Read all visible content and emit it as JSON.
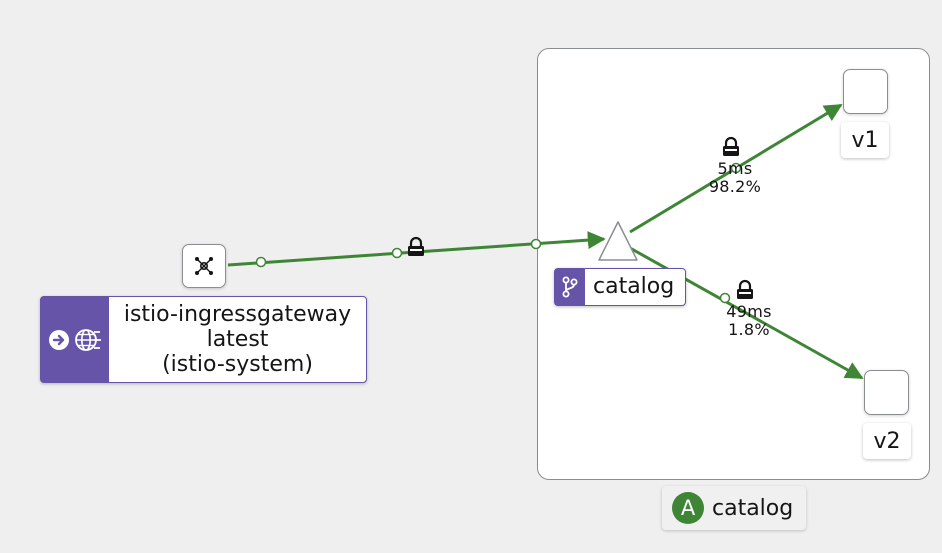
{
  "ingress": {
    "name": "istio-ingressgateway",
    "version": "latest",
    "namespace": "(istio-system)"
  },
  "service": {
    "name": "catalog"
  },
  "app": {
    "badge": "A",
    "name": "catalog"
  },
  "versions": [
    {
      "label": "v1"
    },
    {
      "label": "v2"
    }
  ],
  "edges": [
    {
      "from": "istio-ingressgateway",
      "to": "catalog",
      "mtls": true
    },
    {
      "from": "catalog",
      "to": "v1",
      "mtls": true,
      "response_time": "5ms",
      "percent": "98.2%"
    },
    {
      "from": "catalog",
      "to": "v2",
      "mtls": true,
      "response_time": "49ms",
      "percent": "1.8%"
    }
  ],
  "colors": {
    "edge": "#3e8635",
    "badge": "#6554a8",
    "app_badge": "#3e8635",
    "node_border": "#8a8d90"
  },
  "icons": {
    "ingress": "topology-icon",
    "service": "git-branch-icon",
    "gateway": [
      "arrow-circle-right-icon",
      "globe-icon"
    ],
    "lock": "lock-icon"
  }
}
